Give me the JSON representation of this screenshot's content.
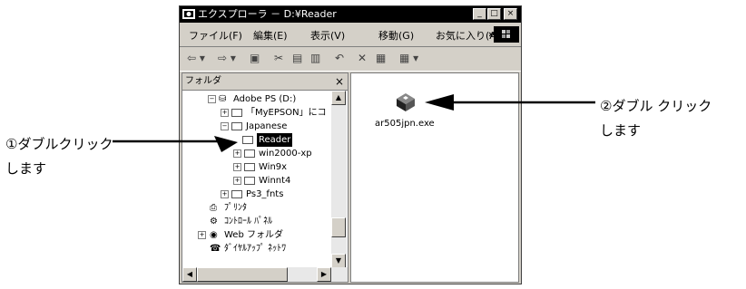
{
  "window": {
    "title": "エクスプローラ － D:¥Reader",
    "buttons": {
      "minimize": "_",
      "maximize": "□",
      "close": "×"
    }
  },
  "menu": {
    "items": [
      "ファイル(F)",
      "編集(E)",
      "表示(V)",
      "移動(G)",
      "お気に入り(A"
    ],
    "overflow": "»"
  },
  "folder_pane": {
    "header": "フォルダ",
    "close": "×",
    "tree": [
      {
        "label": "Adobe PS (D:)",
        "expander": "⊟"
      },
      {
        "label": "「MyEPSON」にコ",
        "expander": "⊞"
      },
      {
        "label": "Japanese",
        "expander": "⊟"
      },
      {
        "label": "Reader",
        "expander": "",
        "selected": true
      },
      {
        "label": "win2000-xp",
        "expander": "⊞"
      },
      {
        "label": "Win9x",
        "expander": "⊞"
      },
      {
        "label": "Winnt4",
        "expander": "⊞"
      },
      {
        "label": "Ps3_fnts",
        "expander": "⊞"
      },
      {
        "label": "ﾌﾟﾘﾝﾀ",
        "expander": ""
      },
      {
        "label": "ｺﾝﾄﾛｰﾙ ﾊﾟﾈﾙ",
        "expander": ""
      },
      {
        "label": "Web フォルダ",
        "expander": "⊞"
      },
      {
        "label": "ﾀﾞｲﾔﾙｱｯﾌﾟ ﾈｯﾄﾜ",
        "expander": ""
      }
    ]
  },
  "file_pane": {
    "file": {
      "name": "ar505jpn.exe"
    }
  },
  "annotations": {
    "left": {
      "line1": "①ダブルクリック",
      "line2": "します"
    },
    "right": {
      "line1": "②ダブル クリック",
      "line2": "します"
    }
  }
}
